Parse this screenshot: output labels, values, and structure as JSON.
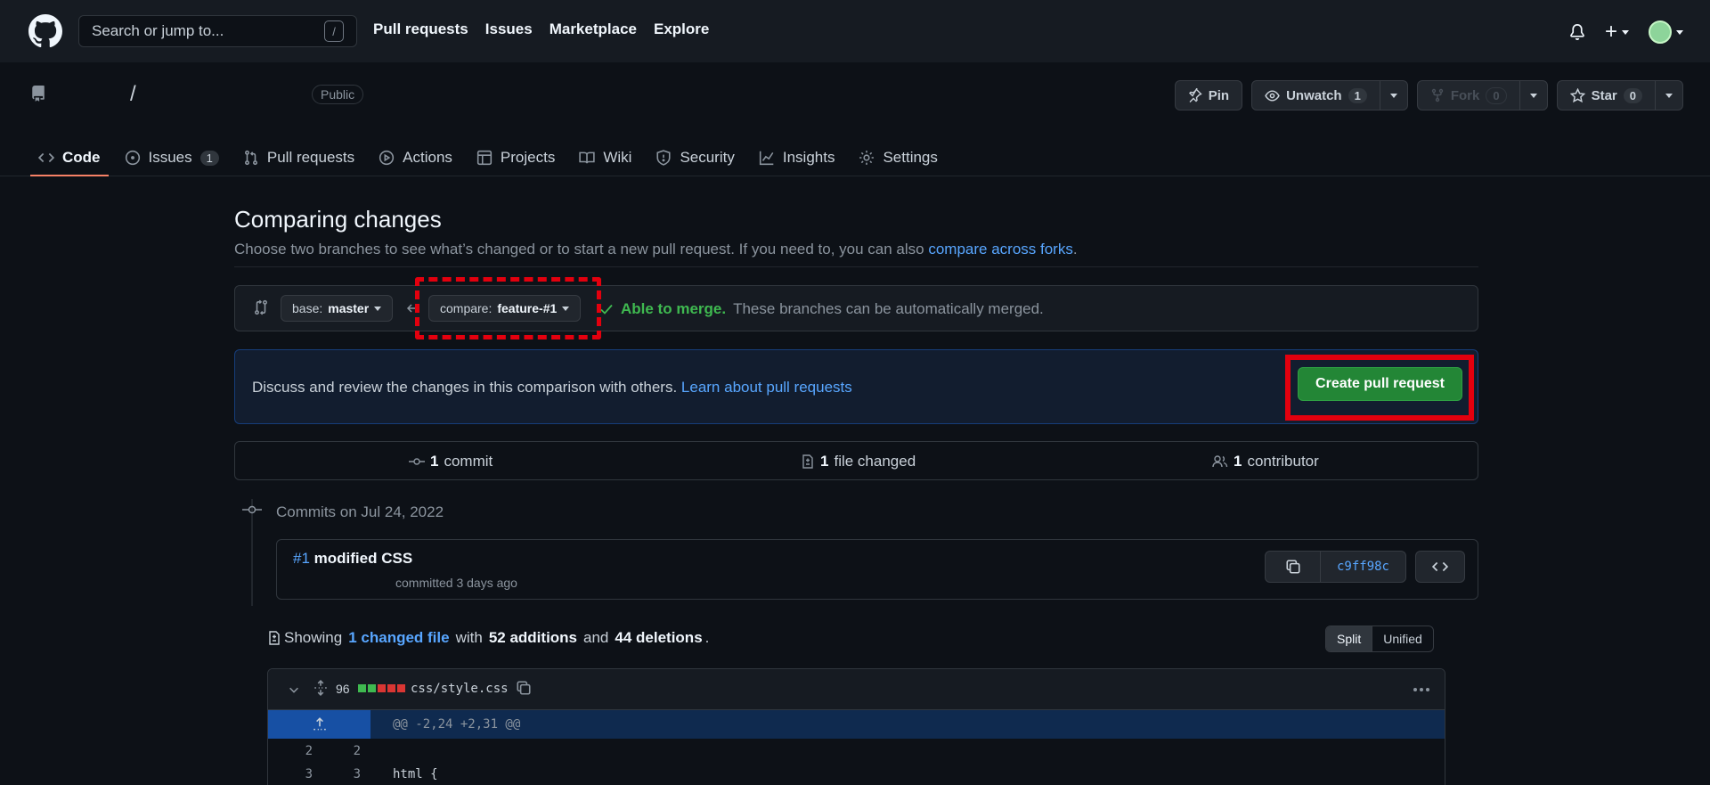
{
  "header": {
    "search_placeholder": "Search or jump to...",
    "search_shortcut": "/",
    "nav": [
      "Pull requests",
      "Issues",
      "Marketplace",
      "Explore"
    ],
    "plus_label": "+"
  },
  "repo": {
    "slash": "/",
    "visibility": "Public",
    "pin_label": "Pin",
    "unwatch_label": "Unwatch",
    "watch_count": "1",
    "fork_label": "Fork",
    "fork_count": "0",
    "star_label": "Star",
    "star_count": "0",
    "tabs": [
      {
        "label": "Code",
        "icon": "code-icon"
      },
      {
        "label": "Issues",
        "icon": "issue-icon",
        "count": "1"
      },
      {
        "label": "Pull requests",
        "icon": "pull-request-icon"
      },
      {
        "label": "Actions",
        "icon": "play-icon"
      },
      {
        "label": "Projects",
        "icon": "table-icon"
      },
      {
        "label": "Wiki",
        "icon": "book-icon"
      },
      {
        "label": "Security",
        "icon": "shield-icon"
      },
      {
        "label": "Insights",
        "icon": "graph-icon"
      },
      {
        "label": "Settings",
        "icon": "gear-icon"
      }
    ]
  },
  "compare": {
    "title": "Comparing changes",
    "subtitle": "Choose two branches to see what’s changed or to start a new pull request. If you need to, you can also",
    "subtitle_link": "compare across forks",
    "subtitle_end": ".",
    "base_prefix": "base:",
    "base_branch": "master",
    "compare_prefix": "compare:",
    "compare_branch": "feature-#1",
    "merge_ok": "Able to merge.",
    "merge_text": "These branches can be automatically merged.",
    "discuss_text": "Discuss and review the changes in this comparison with others.",
    "discuss_link": "Learn about pull requests",
    "create_button": "Create pull request"
  },
  "summary": {
    "commits_num": "1",
    "commits_label": "commit",
    "files_num": "1",
    "files_label": "file changed",
    "contrib_num": "1",
    "contrib_label": "contributor"
  },
  "commits": {
    "date_label": "Commits on Jul 24, 2022",
    "items": [
      {
        "num": "#1",
        "message": "modified CSS",
        "meta": "committed 3 days ago",
        "sha": "c9ff98c"
      }
    ]
  },
  "diff": {
    "showing": "Showing",
    "changed_link": "1 changed file",
    "with": "with",
    "additions": "52 additions",
    "and": "and",
    "deletions": "44 deletions",
    "period": ".",
    "split_label": "Split",
    "unified_label": "Unified",
    "file": {
      "changes": "96",
      "path": "css/style.css",
      "diffstat": [
        "#3fb950",
        "#3fb950",
        "#da3633",
        "#da3633",
        "#da3633"
      ],
      "hunk": "@@ -2,24 +2,31 @@",
      "lines": [
        {
          "old": "2",
          "new": "2",
          "code": ""
        },
        {
          "old": "3",
          "new": "3",
          "code": "html {"
        }
      ]
    }
  },
  "colors": {
    "accent_link": "#58a6ff",
    "success": "#3fb950",
    "primary_button": "#238636",
    "highlight_red": "#e3000e",
    "tab_underline": "#f78166"
  }
}
